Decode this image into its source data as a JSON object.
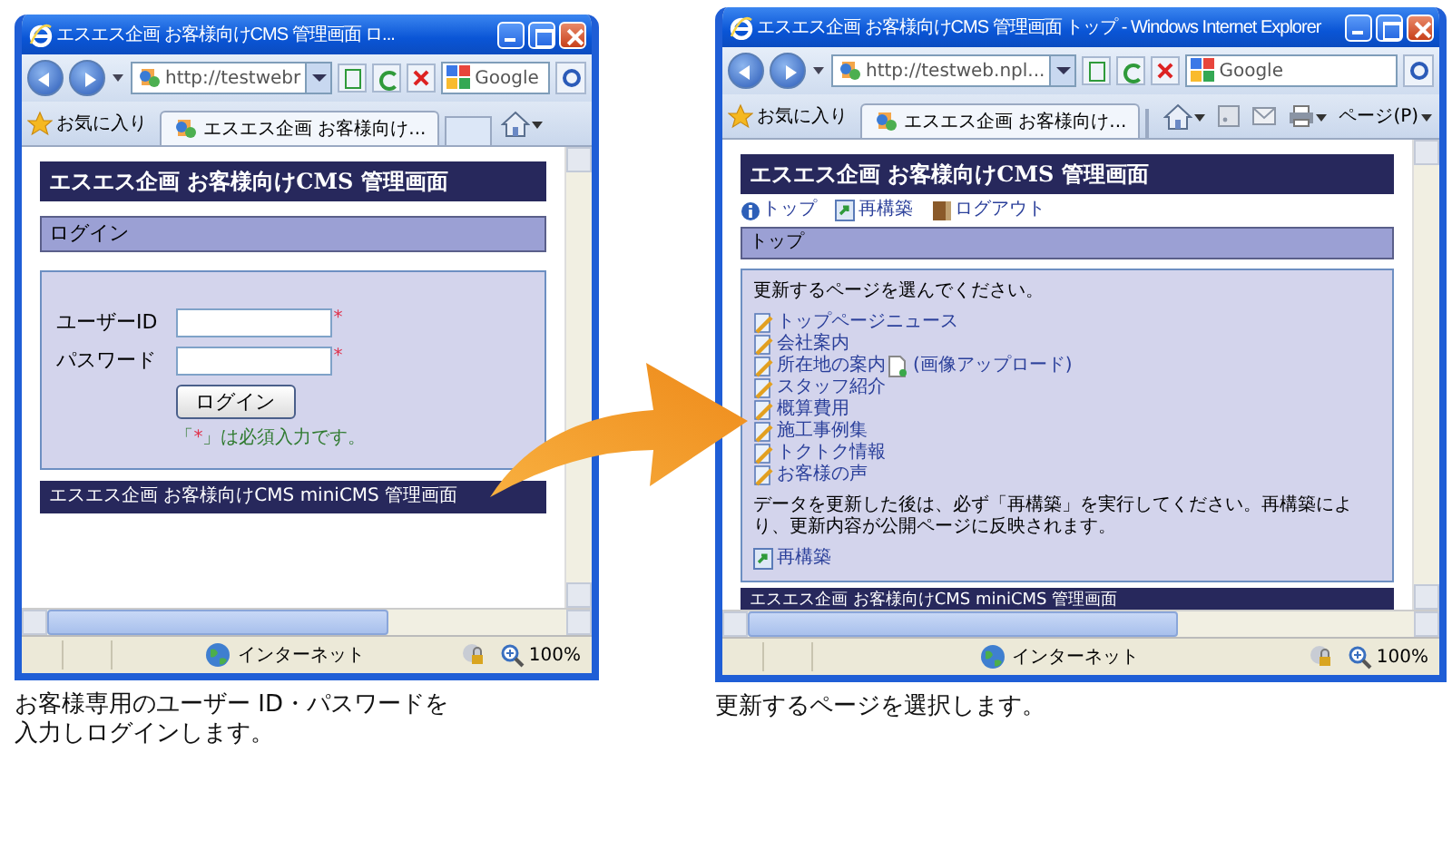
{
  "windows": [
    {
      "title": "エスエス企画 お客様向けCMS 管理画面 ロ...",
      "address": "http://testwebr",
      "search_placeholder": "Google",
      "favorites": "お気に入り",
      "tabs": [
        {
          "label": "エスエス企画 お客様向け...",
          "selected": true
        }
      ],
      "zone": "インターネット",
      "zoom": "100%",
      "page": {
        "kind": "login",
        "header": "エスエス企画 お客様向けCMS 管理画面",
        "section": "ログイン",
        "fields": [
          {
            "label": "ユーザーID",
            "required_mark": "*"
          },
          {
            "label": "パスワード",
            "required_mark": "*"
          }
        ],
        "button": "ログイン",
        "note_parts": [
          "「",
          "*",
          "」は必須入力です。"
        ],
        "footer": "エスエス企画 お客様向けCMS miniCMS 管理画面"
      },
      "caption": [
        "お客様専用のユーザー ID・パスワードを",
        "入力しログインします。"
      ]
    },
    {
      "title": "エスエス企画 お客様向けCMS 管理画面 トップ - Windows Internet Explorer",
      "address": "http://testweb.npl...",
      "search_placeholder": "Google",
      "favorites": "お気に入り",
      "tabs": [
        {
          "label": "エスエス企画 お客様向け...",
          "selected": true
        }
      ],
      "page_menu": "ページ(P)",
      "zone": "インターネット",
      "zoom": "100%",
      "page": {
        "kind": "pages",
        "header": "エスエス企画 お客様向けCMS 管理画面",
        "nav": [
          {
            "label": "トップ",
            "kind": "info"
          },
          {
            "label": "再構築",
            "kind": "rebuild"
          },
          {
            "label": "ログアウト",
            "kind": "door"
          }
        ],
        "section": "トップ",
        "intro": "更新するページを選んでください。",
        "links": [
          {
            "label": "トップページニュース"
          },
          {
            "label": "会社案内"
          },
          {
            "label": "所在地の案内",
            "extra": "(画像アップロード)"
          },
          {
            "label": "スタッフ紹介"
          },
          {
            "label": "概算費用"
          },
          {
            "label": "施工事例集"
          },
          {
            "label": "トクトク情報"
          },
          {
            "label": "お客様の声"
          }
        ],
        "notice": "データを更新した後は、必ず「再構築」を実行してください。再構築により、更新内容が公開ページに反映されます。",
        "rebuild": "再構築",
        "footer": "エスエス企画 お客様向けCMS miniCMS 管理画面"
      },
      "caption": [
        "更新するページを選択します。"
      ]
    }
  ]
}
